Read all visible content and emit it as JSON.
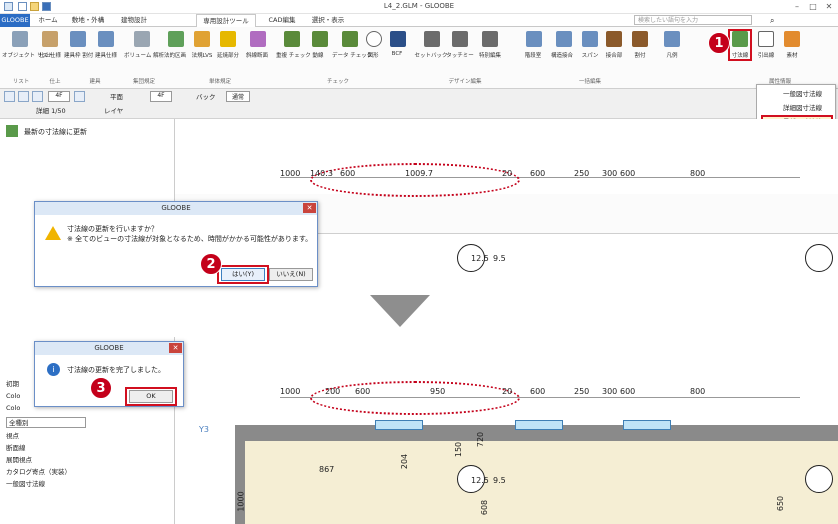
{
  "window": {
    "title": "L4_2.GLM - GLOOBE"
  },
  "tabs": {
    "app": "GLOOBE",
    "home": "ホーム",
    "site": "敷地・外構",
    "building": "建物設計",
    "design_tools": "専用設計ツール",
    "cad": "CAD編集",
    "select": "選択・表示"
  },
  "search_placeholder": "検索したい語句を入力",
  "ribbon": {
    "btn_object_list": "オブジェクト\nリスト",
    "btn_finish": "仕上仕様",
    "btn_fitting_split": "建具枠\n割付",
    "btn_fitting_spec": "建具仕様",
    "btn_volume": "ボリューム\n解析",
    "btn_legal_area": "法的区画",
    "btn_legal_lvs": "法規LVS",
    "btn_extend": "延焼部分",
    "btn_diagonal": "斜線断面",
    "btn_overlap_check": "重複\nチェック",
    "btn_movement": "動線",
    "btn_data_check": "データ\nチェック",
    "btn_shape": "図形",
    "btn_bcf": "BCF",
    "btn_setback": "セットバック",
    "btn_touchup": "タッチミー",
    "btn_special_edit": "特別編集",
    "btn_staircase": "階段室",
    "btn_structure_chk": "構造接合",
    "btn_span": "スパン",
    "btn_joint": "接合部",
    "btn_alloc": "割付",
    "btn_legend": "凡例",
    "btn_label": "ラベル",
    "btn_dimension": "寸法線",
    "btn_leader": "引出線",
    "btn_material": "素材",
    "group_list": "リスト",
    "group_finish": "仕上",
    "group_fitting": "建具",
    "group_collective": "集団規定",
    "group_single": "単体規定",
    "group_check": "チェック",
    "group_design_edit": "デザイン編集",
    "group_bulk": "一括編集",
    "group_attr": "属性情報"
  },
  "dropdown": {
    "item_general": "一般図寸法線",
    "item_detail": "詳細図寸法線",
    "item_update": "最新の寸法線に更新"
  },
  "view_toolbar": {
    "view_plan": "平面",
    "floor": "4F",
    "back": "バック",
    "mode": "通常",
    "detail": "詳細 1/50",
    "layer": "レイヤ"
  },
  "panel": {
    "title": "最新の寸法線に更新"
  },
  "dims_top": [
    "1000",
    "140.3",
    "600",
    "1009.7",
    "20",
    "600",
    "250",
    "300",
    "600",
    "800"
  ],
  "dims_bottom": [
    "1000",
    "200",
    "600",
    "950",
    "20",
    "600",
    "250",
    "300",
    "600",
    "800"
  ],
  "room_dims": [
    "12.5",
    "9.5",
    "608",
    "650",
    "1000",
    "867",
    "204",
    "720",
    "150",
    "608",
    "650"
  ],
  "grid_label": "Y3",
  "dialog_confirm": {
    "title": "GLOOBE",
    "line1": "寸法線の更新を行いますか？",
    "line2": "※ 全てのビューの寸法線が対象となるため、時間がかかる可能性があります。",
    "yes": "はい(Y)",
    "no": "いいえ(N)"
  },
  "dialog_done": {
    "title": "GLOOBE",
    "message": "寸法線の更新を完了しました。",
    "ok": "OK"
  },
  "steps": [
    "1",
    "2",
    "3"
  ],
  "prop_panel": {
    "section": "初期",
    "c1": "Colo",
    "c2": "Colo",
    "filter": "全種別",
    "rows": [
      "視点",
      "断面線",
      "展開視点",
      "カタログ寄点（実装）",
      "一般図寸法線"
    ]
  }
}
